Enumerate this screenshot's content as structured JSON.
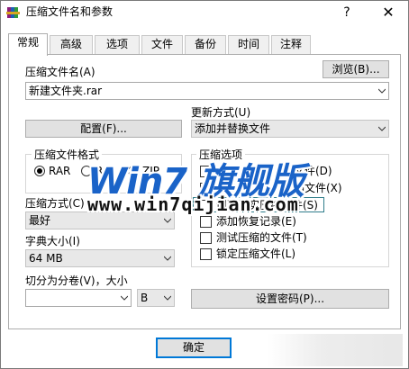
{
  "window": {
    "title": "压缩文件名和参数",
    "help_glyph": "?",
    "close_glyph": "✕",
    "icon": "winrar-books-icon"
  },
  "tabs": [
    {
      "label": "常规",
      "active": true
    },
    {
      "label": "高级"
    },
    {
      "label": "选项"
    },
    {
      "label": "文件"
    },
    {
      "label": "备份"
    },
    {
      "label": "时间"
    },
    {
      "label": "注释"
    }
  ],
  "general": {
    "archive_name_label": "压缩文件名(A)",
    "browse_button": "浏览(B)...",
    "archive_name_value": "新建文件夹.rar",
    "profiles_button": "配置(F)...",
    "update_mode_label": "更新方式(U)",
    "update_mode_value": "添加并替换文件",
    "format_group_label": "压缩文件格式",
    "format_rar": "RAR",
    "format_rar5": "R",
    "format_zip": "ZIP",
    "method_label": "压缩方式(C)",
    "method_value": "最好",
    "dict_label": "字典大小(I)",
    "dict_value": "64 MB",
    "split_label": "切分为分卷(V)，大小",
    "split_value": "",
    "split_unit": "B",
    "options_group_label": "压缩选项",
    "options": [
      {
        "label": "压缩后删除原来的文件(D)",
        "visible": "的文件(D)"
      },
      {
        "label": "创建自解压格式压缩文件(X)",
        "visible": "压缩文件(X)"
      },
      {
        "label": "创建固实压缩文件(S)",
        "visible": "创建固实压缩文件(S)"
      },
      {
        "label": "添加恢复记录(E)"
      },
      {
        "label": "测试压缩的文件(T)"
      },
      {
        "label": "锁定压缩文件(L)"
      }
    ],
    "password_button": "设置密码(P)..."
  },
  "footer": {
    "ok_button": "确定"
  },
  "watermark": {
    "main": "Win7 旗舰版",
    "sub": "www.win7qijian.com"
  }
}
